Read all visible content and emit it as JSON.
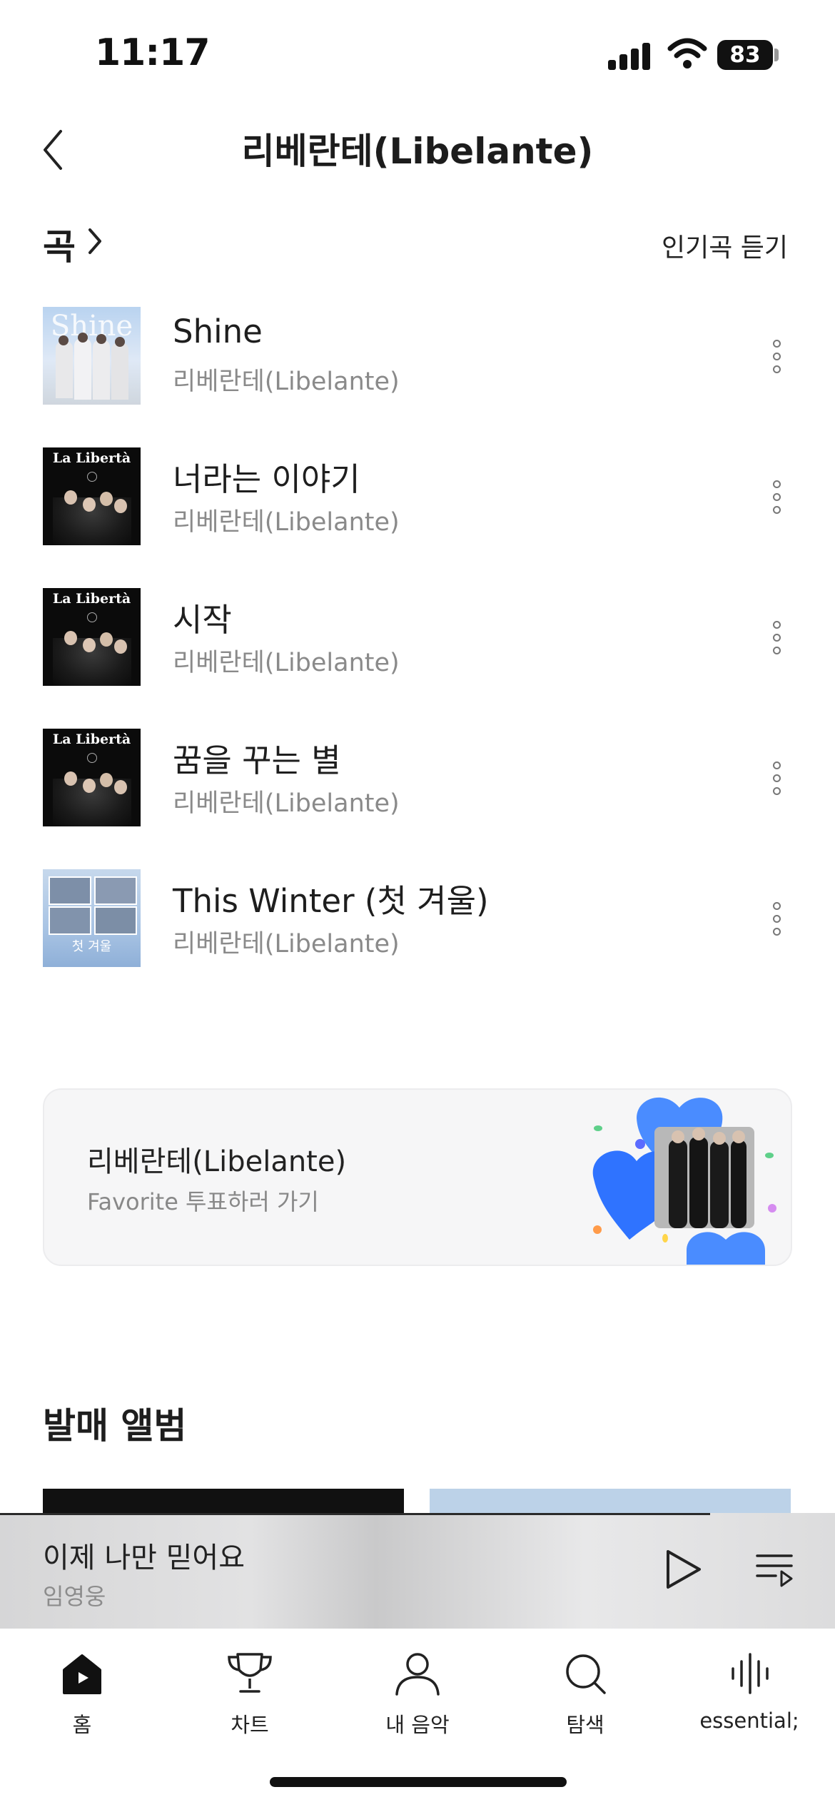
{
  "status_bar": {
    "time": "11:17",
    "battery": "83"
  },
  "header": {
    "title": "리베란테(Libelante)"
  },
  "songs_section": {
    "title": "곡",
    "action": "인기곡 듣기"
  },
  "songs": [
    {
      "title": "Shine",
      "artist": "리베란테(Libelante)",
      "cover_text": "Shine"
    },
    {
      "title": "너라는 이야기",
      "artist": "리베란테(Libelante)",
      "cover_text": "La Libertà"
    },
    {
      "title": "시작",
      "artist": "리베란테(Libelante)",
      "cover_text": "La Libertà"
    },
    {
      "title": "꿈을 꾸는 별",
      "artist": "리베란테(Libelante)",
      "cover_text": "La Libertà"
    },
    {
      "title": "This Winter (첫 겨울)",
      "artist": "리베란테(Libelante)",
      "cover_text": "첫 겨울"
    }
  ],
  "favorite_card": {
    "name": "리베란테(Libelante)",
    "subtitle": "Favorite 투표하러 가기"
  },
  "albums_section": {
    "title": "발매 앨범"
  },
  "mini_player": {
    "title": "이제 나만 믿어요",
    "artist": "임영웅",
    "progress": 0.85
  },
  "tabs": [
    {
      "label": "홈",
      "icon": "home-icon"
    },
    {
      "label": "차트",
      "icon": "trophy-icon"
    },
    {
      "label": "내 음악",
      "icon": "person-icon"
    },
    {
      "label": "탐색",
      "icon": "search-icon"
    },
    {
      "label": "essential;",
      "icon": "waveform-icon"
    }
  ],
  "colors": {
    "accent": "#3a7bff",
    "text": "#1e1e1e",
    "secondary": "#8a8a8a"
  }
}
